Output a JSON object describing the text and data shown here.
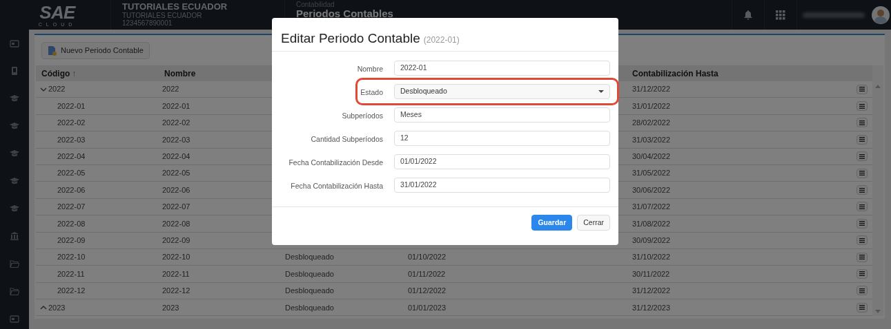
{
  "topbar": {
    "logo": {
      "mark": "SAE",
      "sub": "CLOUD"
    },
    "company": {
      "name": "TUTORIALES ECUADOR",
      "subtitle": "TUTORIALES ECUADOR",
      "ruc": "1234567890001"
    },
    "breadcrumb": {
      "module": "Contabilidad",
      "page": "Periodos Contables"
    }
  },
  "sidebar": {
    "items": [
      {
        "kind": "card"
      },
      {
        "kind": "tablet"
      },
      {
        "kind": "cap"
      },
      {
        "kind": "cap"
      },
      {
        "kind": "cap"
      },
      {
        "kind": "cap"
      },
      {
        "kind": "cap"
      },
      {
        "kind": "bank"
      },
      {
        "kind": "folder"
      },
      {
        "kind": "folder"
      },
      {
        "kind": "card"
      }
    ]
  },
  "toolbar": {
    "new_button": "Nuevo Periodo Contable"
  },
  "table": {
    "columns": [
      {
        "label": "Código",
        "sort_icon": "↑"
      },
      {
        "label": "Nombre"
      },
      {},
      {},
      {
        "label": "Contabilización Hasta"
      }
    ],
    "rows": [
      {
        "code": "2022",
        "name": "2022",
        "hasta": "31/12/2022",
        "expanded": true,
        "children": [
          {
            "code": "2022-01",
            "name": "2022-01",
            "hasta": "31/01/2022"
          },
          {
            "code": "2022-02",
            "name": "2022-02",
            "hasta": "28/02/2022"
          },
          {
            "code": "2022-03",
            "name": "2022-03",
            "hasta": "31/03/2022"
          },
          {
            "code": "2022-04",
            "name": "2022-04",
            "hasta": "30/04/2022"
          },
          {
            "code": "2022-05",
            "name": "2022-05",
            "hasta": "31/05/2022"
          },
          {
            "code": "2022-06",
            "name": "2022-06",
            "hasta": "30/06/2022"
          },
          {
            "code": "2022-07",
            "name": "2022-07",
            "hasta": "31/07/2022"
          },
          {
            "code": "2022-08",
            "name": "2022-08",
            "hasta": "31/08/2022"
          },
          {
            "code": "2022-09",
            "name": "2022-09",
            "hasta": "30/09/2022"
          },
          {
            "code": "2022-10",
            "name": "2022-10",
            "estado": "Desbloqueado",
            "desde": "01/10/2022",
            "hasta": "31/10/2022"
          },
          {
            "code": "2022-11",
            "name": "2022-11",
            "estado": "Desbloqueado",
            "desde": "01/11/2022",
            "hasta": "30/11/2022"
          },
          {
            "code": "2022-12",
            "name": "2022-12",
            "estado": "Desbloqueado",
            "desde": "01/12/2022",
            "hasta": "31/12/2022"
          }
        ]
      },
      {
        "code": "2023",
        "name": "2023",
        "estado": "Desbloqueado",
        "desde": "01/01/2023",
        "hasta": "31/12/2023",
        "expanded": false
      }
    ]
  },
  "modal": {
    "title": "Editar Periodo Contable",
    "subtitle": "(2022-01)",
    "fields": [
      {
        "label": "Nombre",
        "value": "2022-01",
        "kind": "text"
      },
      {
        "label": "Estado",
        "value": "Desbloqueado",
        "kind": "select",
        "highlighted": true
      },
      {
        "label": "Subperíodos",
        "value": "Meses",
        "kind": "text"
      },
      {
        "label": "Cantidad Subperíodos",
        "value": "12",
        "kind": "text"
      },
      {
        "label": "Fecha Contabilización Desde",
        "value": "01/01/2022",
        "kind": "text"
      },
      {
        "label": "Fecha Contabilización Hasta",
        "value": "31/01/2022",
        "kind": "text"
      }
    ],
    "buttons": [
      {
        "label": "Guardar",
        "kind": "primary"
      },
      {
        "label": "Cerrar",
        "kind": "default"
      }
    ]
  }
}
